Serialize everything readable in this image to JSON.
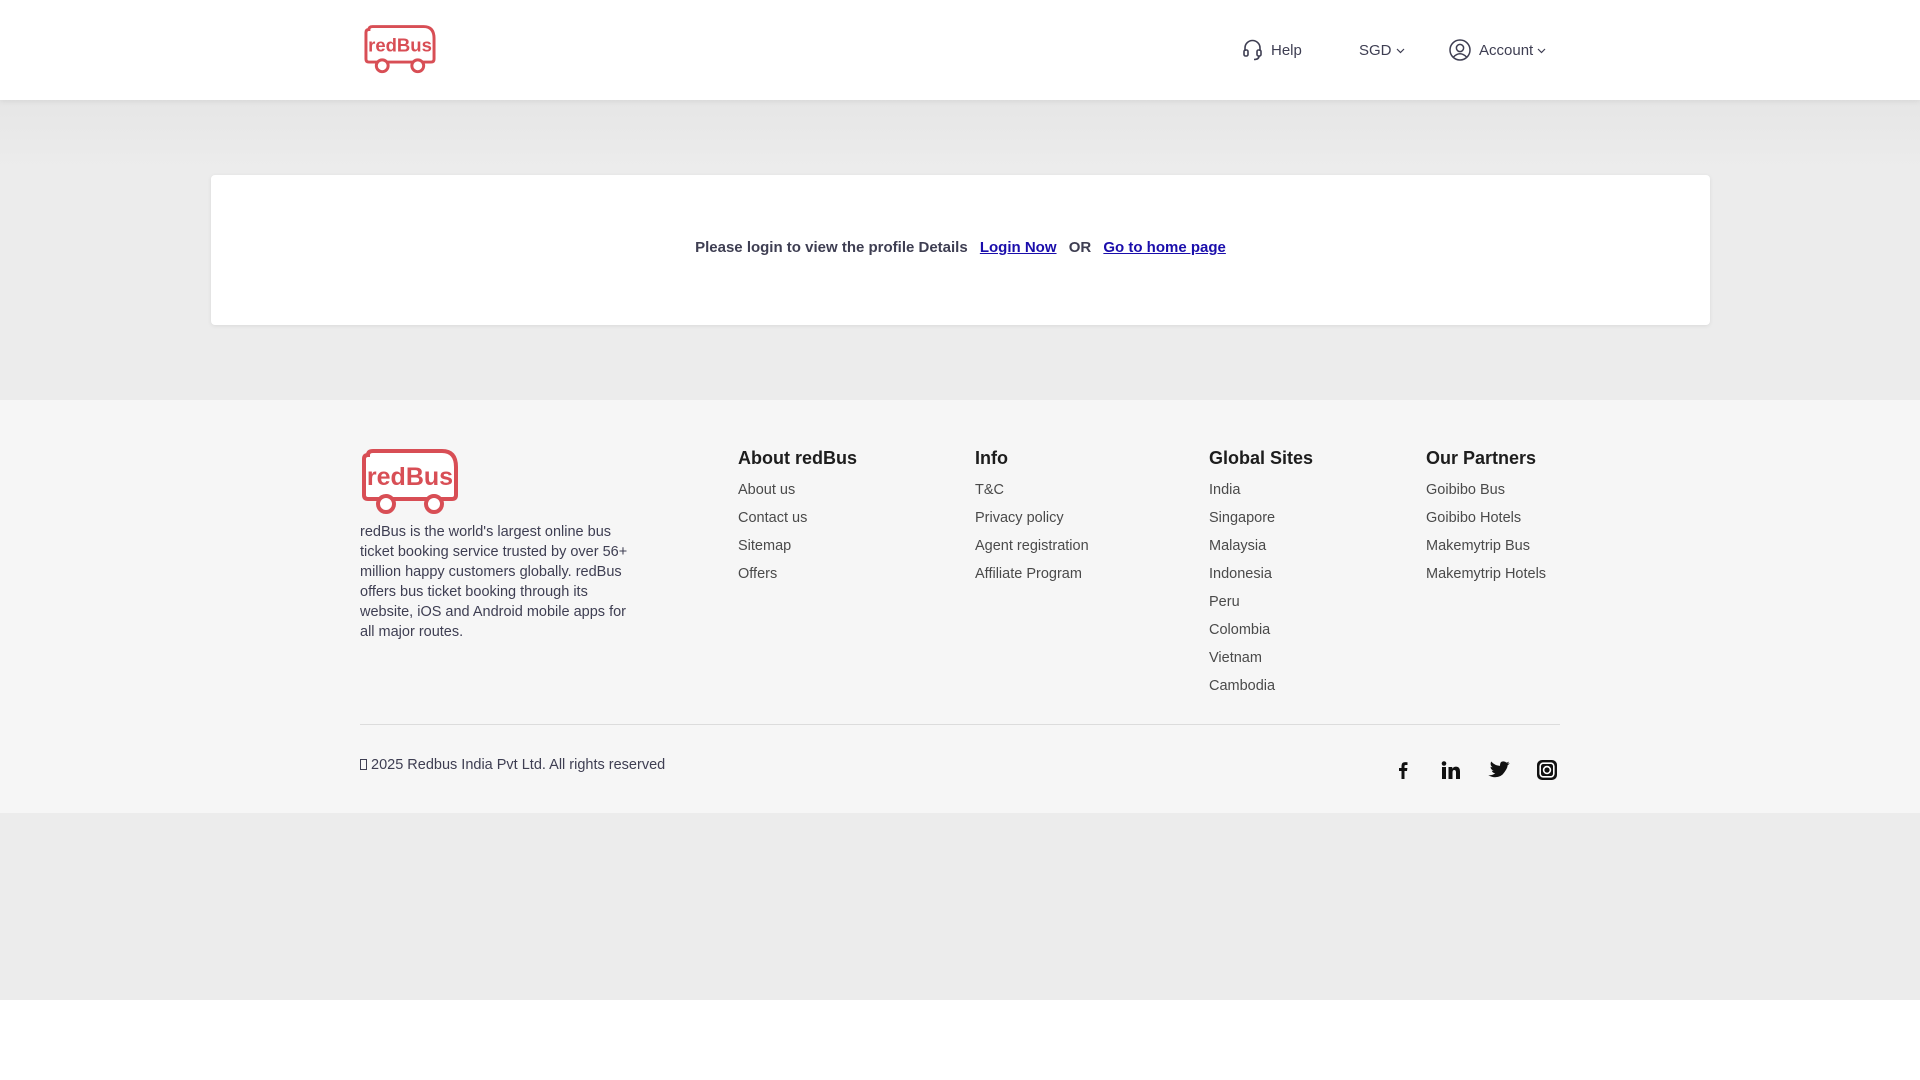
{
  "header": {
    "logo_text": "redBus",
    "help_label": "Help",
    "currency_label": "SGD",
    "account_label": "Account",
    "icons": {
      "help": "headset-icon",
      "account": "user-circle-icon",
      "dropdown": "chevron-down-icon"
    }
  },
  "login_card": {
    "message": "Please login to view the profile Details",
    "login_link": "Login Now",
    "or_text": "OR",
    "home_link": "Go to home page"
  },
  "footer": {
    "logo_text": "redBus",
    "about_text": "redBus is the world's largest online bus ticket booking service trusted by over 56+ million happy customers globally. redBus offers bus ticket booking through its website, iOS and Android mobile apps for all major routes.",
    "columns": [
      {
        "title": "About redBus",
        "items": [
          "About us",
          "Contact us",
          "Sitemap",
          "Offers"
        ]
      },
      {
        "title": "Info",
        "items": [
          "T&C",
          "Privacy policy",
          "Agent registration",
          "Affiliate Program"
        ]
      },
      {
        "title": "Global Sites",
        "items": [
          "India",
          "Singapore",
          "Malaysia",
          "Indonesia",
          "Peru",
          "Colombia",
          "Vietnam",
          "Cambodia"
        ]
      },
      {
        "title": "Our Partners",
        "items": [
          "Goibibo Bus",
          "Goibibo Hotels",
          "Makemytrip Bus",
          "Makemytrip Hotels"
        ]
      }
    ],
    "copyright": "2025 Redbus India Pvt Ltd. All rights reserved",
    "social_icons": [
      "facebook-icon",
      "linkedin-icon",
      "twitter-icon",
      "instagram-icon"
    ]
  },
  "colors": {
    "brand_red": "#d84e55",
    "link_blue": "#1a0dab",
    "page_gray": "#ececec",
    "footer_bg": "#f6f6f6"
  }
}
